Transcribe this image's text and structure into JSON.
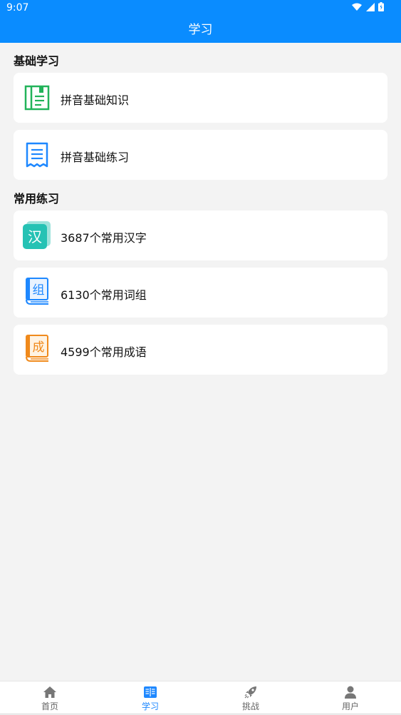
{
  "status": {
    "time": "9:07"
  },
  "header": {
    "title": "学习"
  },
  "sections": [
    {
      "title": "基础学习",
      "items": [
        {
          "label": "拼音基础知识",
          "icon": "notebook-icon"
        },
        {
          "label": "拼音基础练习",
          "icon": "receipt-list-icon"
        }
      ]
    },
    {
      "title": "常用练习",
      "items": [
        {
          "label": "3687个常用汉字",
          "icon": "han-character-icon",
          "icon_char": "汉"
        },
        {
          "label": "6130个常用词组",
          "icon": "book-zu-icon",
          "icon_char": "组"
        },
        {
          "label": "4599个常用成语",
          "icon": "book-cheng-icon",
          "icon_char": "成"
        }
      ]
    }
  ],
  "tabs": [
    {
      "label": "首页",
      "icon": "home-icon",
      "active": false
    },
    {
      "label": "学习",
      "icon": "book-open-icon",
      "active": true
    },
    {
      "label": "挑战",
      "icon": "rocket-icon",
      "active": false
    },
    {
      "label": "用户",
      "icon": "user-icon",
      "active": false
    }
  ],
  "colors": {
    "primary": "#0a8cff",
    "green": "#22b35a",
    "blue": "#1e88ff",
    "teal": "#26c2b4",
    "orange": "#f08a1c",
    "bg": "#f3f3f3"
  }
}
